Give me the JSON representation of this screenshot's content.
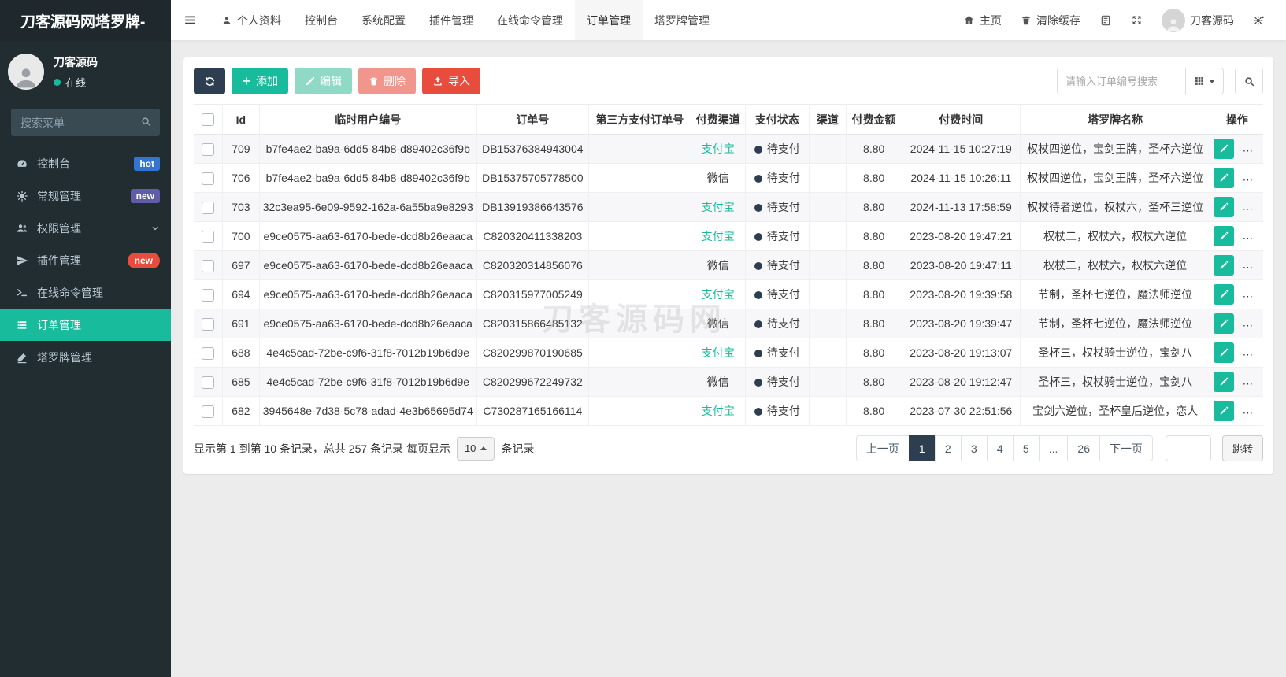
{
  "brand": {
    "title": "刀客源码网塔罗牌-"
  },
  "navbar": {
    "items": [
      {
        "label": "个人资料"
      },
      {
        "label": "控制台"
      },
      {
        "label": "系统配置"
      },
      {
        "label": "插件管理"
      },
      {
        "label": "在线命令管理"
      },
      {
        "label": "订单管理"
      },
      {
        "label": "塔罗牌管理"
      }
    ],
    "right": {
      "home_label": "主页",
      "clear_cache_label": "清除缓存",
      "username": "刀客源码"
    }
  },
  "sidebar": {
    "user": {
      "name": "刀客源码",
      "status": "在线"
    },
    "search_placeholder": "搜索菜单",
    "items": [
      {
        "label": "控制台",
        "badge": "hot"
      },
      {
        "label": "常规管理",
        "badge": "new"
      },
      {
        "label": "权限管理"
      },
      {
        "label": "插件管理",
        "badge": "new"
      },
      {
        "label": "在线命令管理"
      },
      {
        "label": "订单管理"
      },
      {
        "label": "塔罗牌管理"
      }
    ]
  },
  "toolbar": {
    "add_label": "添加",
    "edit_label": "编辑",
    "delete_label": "删除",
    "import_label": "导入",
    "search_placeholder": "请输入订单编号搜索"
  },
  "table": {
    "columns": [
      "Id",
      "临时用户编号",
      "订单号",
      "第三方支付订单号",
      "付费渠道",
      "支付状态",
      "渠道",
      "付费金额",
      "付费时间",
      "塔罗牌名称",
      "操作"
    ],
    "rows": [
      {
        "id": "709",
        "user_no": "b7fe4ae2-ba9a-6dd5-84b8-d89402c36f9b",
        "order_no": "DB15376384943004",
        "third_no": "",
        "channel": "支付宝",
        "status": "待支付",
        "sub_channel": "",
        "amount": "8.80",
        "time": "2024-11-15 10:27:19",
        "tarot": "权杖四逆位，宝剑王牌，圣杯六逆位"
      },
      {
        "id": "706",
        "user_no": "b7fe4ae2-ba9a-6dd5-84b8-d89402c36f9b",
        "order_no": "DB15375705778500",
        "third_no": "",
        "channel": "微信",
        "status": "待支付",
        "sub_channel": "",
        "amount": "8.80",
        "time": "2024-11-15 10:26:11",
        "tarot": "权杖四逆位，宝剑王牌，圣杯六逆位"
      },
      {
        "id": "703",
        "user_no": "32c3ea95-6e09-9592-162a-6a55ba9e8293",
        "order_no": "DB13919386643576",
        "third_no": "",
        "channel": "支付宝",
        "status": "待支付",
        "sub_channel": "",
        "amount": "8.80",
        "time": "2024-11-13 17:58:59",
        "tarot": "权杖待者逆位，权杖六，圣杯三逆位"
      },
      {
        "id": "700",
        "user_no": "e9ce0575-aa63-6170-bede-dcd8b26eaaca",
        "order_no": "C820320411338203",
        "third_no": "",
        "channel": "支付宝",
        "status": "待支付",
        "sub_channel": "",
        "amount": "8.80",
        "time": "2023-08-20 19:47:21",
        "tarot": "权杖二，权杖六，权杖六逆位"
      },
      {
        "id": "697",
        "user_no": "e9ce0575-aa63-6170-bede-dcd8b26eaaca",
        "order_no": "C820320314856076",
        "third_no": "",
        "channel": "微信",
        "status": "待支付",
        "sub_channel": "",
        "amount": "8.80",
        "time": "2023-08-20 19:47:11",
        "tarot": "权杖二，权杖六，权杖六逆位"
      },
      {
        "id": "694",
        "user_no": "e9ce0575-aa63-6170-bede-dcd8b26eaaca",
        "order_no": "C820315977005249",
        "third_no": "",
        "channel": "支付宝",
        "status": "待支付",
        "sub_channel": "",
        "amount": "8.80",
        "time": "2023-08-20 19:39:58",
        "tarot": "节制，圣杯七逆位，魔法师逆位"
      },
      {
        "id": "691",
        "user_no": "e9ce0575-aa63-6170-bede-dcd8b26eaaca",
        "order_no": "C820315866485132",
        "third_no": "",
        "channel": "微信",
        "status": "待支付",
        "sub_channel": "",
        "amount": "8.80",
        "time": "2023-08-20 19:39:47",
        "tarot": "节制，圣杯七逆位，魔法师逆位"
      },
      {
        "id": "688",
        "user_no": "4e4c5cad-72be-c9f6-31f8-7012b19b6d9e",
        "order_no": "C820299870190685",
        "third_no": "",
        "channel": "支付宝",
        "status": "待支付",
        "sub_channel": "",
        "amount": "8.80",
        "time": "2023-08-20 19:13:07",
        "tarot": "圣杯三，权杖骑士逆位，宝剑八"
      },
      {
        "id": "685",
        "user_no": "4e4c5cad-72be-c9f6-31f8-7012b19b6d9e",
        "order_no": "C820299672249732",
        "third_no": "",
        "channel": "微信",
        "status": "待支付",
        "sub_channel": "",
        "amount": "8.80",
        "time": "2023-08-20 19:12:47",
        "tarot": "圣杯三，权杖骑士逆位，宝剑八"
      },
      {
        "id": "682",
        "user_no": "3945648e-7d38-5c78-adad-4e3b65695d74",
        "order_no": "C730287165166114",
        "third_no": "",
        "channel": "支付宝",
        "status": "待支付",
        "sub_channel": "",
        "amount": "8.80",
        "time": "2023-07-30 22:51:56",
        "tarot": "宝剑六逆位，圣杯皇后逆位，恋人"
      }
    ]
  },
  "pagination": {
    "summary_prefix": "显示第 1 到第 10 条记录，总共 257 条记录 每页显示",
    "page_size": "10",
    "summary_suffix": "条记录",
    "prev_label": "上一页",
    "next_label": "下一页",
    "pages": [
      "1",
      "2",
      "3",
      "4",
      "5",
      "...",
      "26"
    ],
    "active_page": "1",
    "jump_label": "跳转"
  },
  "watermark": "刀客源码网",
  "colors": {
    "accent_teal": "#18bc9c",
    "dark_navy": "#2c3e50",
    "danger_red": "#e74c3c",
    "badge_hot_blue": "#3276d2",
    "badge_new_purple": "#605ca8",
    "channel": {
      "支付宝": "#18bc9c",
      "微信": "#3b3b3b"
    }
  }
}
